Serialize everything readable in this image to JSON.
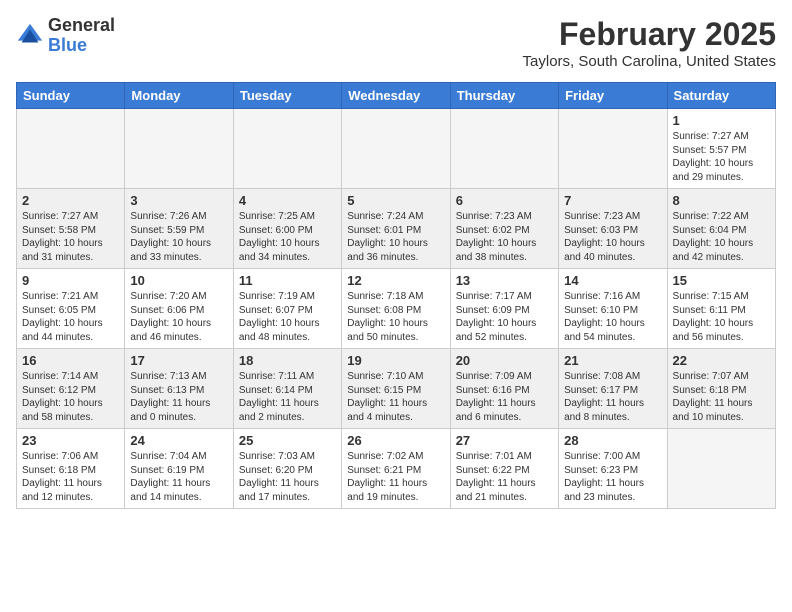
{
  "header": {
    "logo_general": "General",
    "logo_blue": "Blue",
    "month_title": "February 2025",
    "location": "Taylors, South Carolina, United States"
  },
  "weekdays": [
    "Sunday",
    "Monday",
    "Tuesday",
    "Wednesday",
    "Thursday",
    "Friday",
    "Saturday"
  ],
  "weeks": [
    {
      "shaded": false,
      "days": [
        {
          "num": "",
          "info": ""
        },
        {
          "num": "",
          "info": ""
        },
        {
          "num": "",
          "info": ""
        },
        {
          "num": "",
          "info": ""
        },
        {
          "num": "",
          "info": ""
        },
        {
          "num": "",
          "info": ""
        },
        {
          "num": "1",
          "info": "Sunrise: 7:27 AM\nSunset: 5:57 PM\nDaylight: 10 hours\nand 29 minutes."
        }
      ]
    },
    {
      "shaded": true,
      "days": [
        {
          "num": "2",
          "info": "Sunrise: 7:27 AM\nSunset: 5:58 PM\nDaylight: 10 hours\nand 31 minutes."
        },
        {
          "num": "3",
          "info": "Sunrise: 7:26 AM\nSunset: 5:59 PM\nDaylight: 10 hours\nand 33 minutes."
        },
        {
          "num": "4",
          "info": "Sunrise: 7:25 AM\nSunset: 6:00 PM\nDaylight: 10 hours\nand 34 minutes."
        },
        {
          "num": "5",
          "info": "Sunrise: 7:24 AM\nSunset: 6:01 PM\nDaylight: 10 hours\nand 36 minutes."
        },
        {
          "num": "6",
          "info": "Sunrise: 7:23 AM\nSunset: 6:02 PM\nDaylight: 10 hours\nand 38 minutes."
        },
        {
          "num": "7",
          "info": "Sunrise: 7:23 AM\nSunset: 6:03 PM\nDaylight: 10 hours\nand 40 minutes."
        },
        {
          "num": "8",
          "info": "Sunrise: 7:22 AM\nSunset: 6:04 PM\nDaylight: 10 hours\nand 42 minutes."
        }
      ]
    },
    {
      "shaded": false,
      "days": [
        {
          "num": "9",
          "info": "Sunrise: 7:21 AM\nSunset: 6:05 PM\nDaylight: 10 hours\nand 44 minutes."
        },
        {
          "num": "10",
          "info": "Sunrise: 7:20 AM\nSunset: 6:06 PM\nDaylight: 10 hours\nand 46 minutes."
        },
        {
          "num": "11",
          "info": "Sunrise: 7:19 AM\nSunset: 6:07 PM\nDaylight: 10 hours\nand 48 minutes."
        },
        {
          "num": "12",
          "info": "Sunrise: 7:18 AM\nSunset: 6:08 PM\nDaylight: 10 hours\nand 50 minutes."
        },
        {
          "num": "13",
          "info": "Sunrise: 7:17 AM\nSunset: 6:09 PM\nDaylight: 10 hours\nand 52 minutes."
        },
        {
          "num": "14",
          "info": "Sunrise: 7:16 AM\nSunset: 6:10 PM\nDaylight: 10 hours\nand 54 minutes."
        },
        {
          "num": "15",
          "info": "Sunrise: 7:15 AM\nSunset: 6:11 PM\nDaylight: 10 hours\nand 56 minutes."
        }
      ]
    },
    {
      "shaded": true,
      "days": [
        {
          "num": "16",
          "info": "Sunrise: 7:14 AM\nSunset: 6:12 PM\nDaylight: 10 hours\nand 58 minutes."
        },
        {
          "num": "17",
          "info": "Sunrise: 7:13 AM\nSunset: 6:13 PM\nDaylight: 11 hours\nand 0 minutes."
        },
        {
          "num": "18",
          "info": "Sunrise: 7:11 AM\nSunset: 6:14 PM\nDaylight: 11 hours\nand 2 minutes."
        },
        {
          "num": "19",
          "info": "Sunrise: 7:10 AM\nSunset: 6:15 PM\nDaylight: 11 hours\nand 4 minutes."
        },
        {
          "num": "20",
          "info": "Sunrise: 7:09 AM\nSunset: 6:16 PM\nDaylight: 11 hours\nand 6 minutes."
        },
        {
          "num": "21",
          "info": "Sunrise: 7:08 AM\nSunset: 6:17 PM\nDaylight: 11 hours\nand 8 minutes."
        },
        {
          "num": "22",
          "info": "Sunrise: 7:07 AM\nSunset: 6:18 PM\nDaylight: 11 hours\nand 10 minutes."
        }
      ]
    },
    {
      "shaded": false,
      "days": [
        {
          "num": "23",
          "info": "Sunrise: 7:06 AM\nSunset: 6:18 PM\nDaylight: 11 hours\nand 12 minutes."
        },
        {
          "num": "24",
          "info": "Sunrise: 7:04 AM\nSunset: 6:19 PM\nDaylight: 11 hours\nand 14 minutes."
        },
        {
          "num": "25",
          "info": "Sunrise: 7:03 AM\nSunset: 6:20 PM\nDaylight: 11 hours\nand 17 minutes."
        },
        {
          "num": "26",
          "info": "Sunrise: 7:02 AM\nSunset: 6:21 PM\nDaylight: 11 hours\nand 19 minutes."
        },
        {
          "num": "27",
          "info": "Sunrise: 7:01 AM\nSunset: 6:22 PM\nDaylight: 11 hours\nand 21 minutes."
        },
        {
          "num": "28",
          "info": "Sunrise: 7:00 AM\nSunset: 6:23 PM\nDaylight: 11 hours\nand 23 minutes."
        },
        {
          "num": "",
          "info": ""
        }
      ]
    }
  ]
}
